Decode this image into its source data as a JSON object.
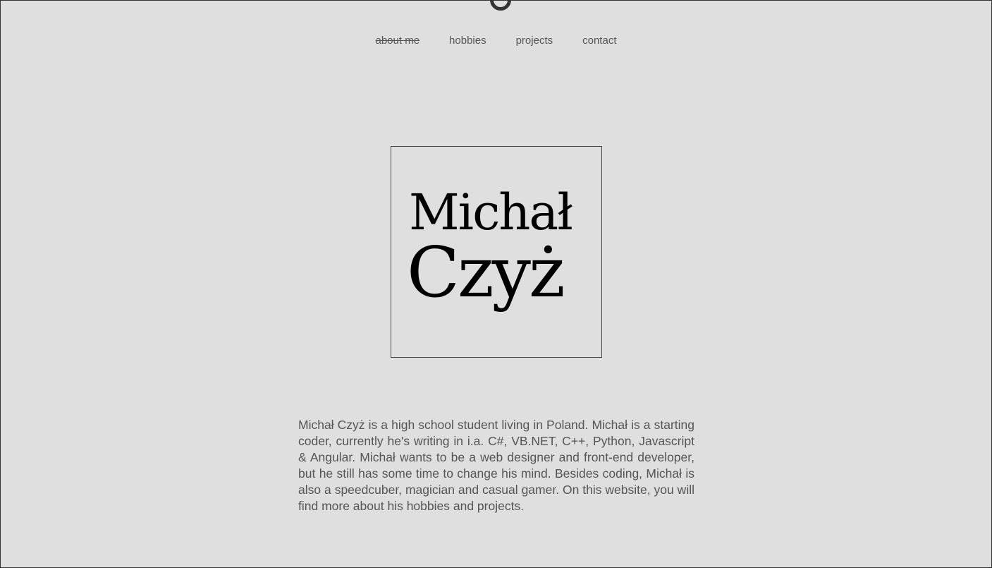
{
  "nav": {
    "items": [
      {
        "label": "about me"
      },
      {
        "label": "hobbies"
      },
      {
        "label": "projects"
      },
      {
        "label": "contact"
      }
    ]
  },
  "logo": {
    "first": "Michał",
    "last": "Czyż"
  },
  "bio": "Michał Czyż is a high school student living in Poland. Michał is a starting coder, currently he's writing in i.a. C#, VB.NET, C++, Python, Javascript & Angular. Michał wants to be a web designer and front-end developer, but he still has some time to change his mind. Besides coding, Michał is also a speedcuber, magician and casual gamer. On this website, you will find more about his hobbies and projects."
}
